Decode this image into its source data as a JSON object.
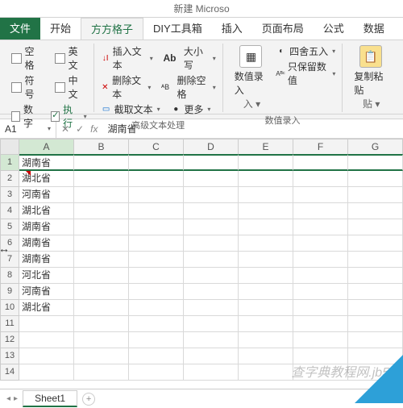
{
  "title": "新建 Microso",
  "tabs": {
    "file": "文件",
    "home": "开始",
    "fgz": "方方格子",
    "diy": "DIY工具箱",
    "insert": "插入",
    "layout": "页面布局",
    "formula": "公式",
    "data": "数据"
  },
  "g1": {
    "kongge": "空格",
    "yingwen": "英文",
    "fuhao": "符号",
    "zhongwen": "中文",
    "shuzi": "数字",
    "zhixing": "执行"
  },
  "g2": {
    "insert": "插入文本",
    "delete": "删除文本",
    "intercept": "截取文本",
    "label": "高级文本处理"
  },
  "g3": {
    "case": "大小写",
    "delsp": "删除空格",
    "more": "更多"
  },
  "g4": {
    "numin": "数值录入",
    "round": "四舍五入",
    "keepnum": "只保留数值",
    "label": "数值录入"
  },
  "g5": {
    "paste": "复制粘贴"
  },
  "namebox": "A1",
  "formula": "湖南省",
  "cols": [
    "A",
    "B",
    "C",
    "D",
    "E",
    "F",
    "G"
  ],
  "rows": [
    {
      "n": 1,
      "v": "湖南省"
    },
    {
      "n": 2,
      "v": "湖北省"
    },
    {
      "n": 3,
      "v": "河南省"
    },
    {
      "n": 4,
      "v": "湖北省"
    },
    {
      "n": 5,
      "v": "湖南省"
    },
    {
      "n": 6,
      "v": "湖南省"
    },
    {
      "n": 7,
      "v": "湖南省"
    },
    {
      "n": 8,
      "v": "河北省"
    },
    {
      "n": 9,
      "v": "河南省"
    },
    {
      "n": 10,
      "v": "湖北省"
    },
    {
      "n": 11,
      "v": ""
    },
    {
      "n": 12,
      "v": ""
    },
    {
      "n": 13,
      "v": ""
    },
    {
      "n": 14,
      "v": ""
    }
  ],
  "sheet": "Sheet1",
  "watermark": "查字典教程网.jb51"
}
